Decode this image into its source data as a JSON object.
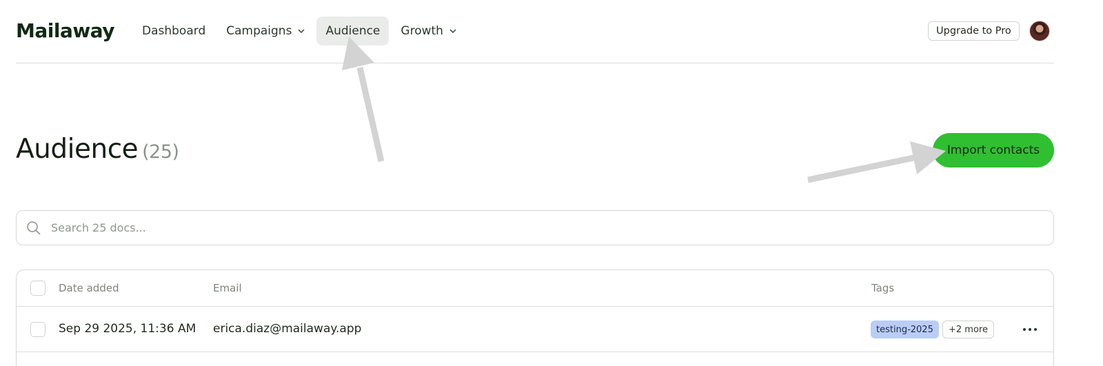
{
  "header": {
    "logo": "Mailaway",
    "nav": [
      {
        "label": "Dashboard",
        "has_dropdown": false,
        "active": false
      },
      {
        "label": "Campaigns",
        "has_dropdown": true,
        "active": false
      },
      {
        "label": "Audience",
        "has_dropdown": false,
        "active": true
      },
      {
        "label": "Growth",
        "has_dropdown": true,
        "active": false
      }
    ],
    "upgrade_label": "Upgrade to Pro"
  },
  "page": {
    "title": "Audience",
    "count": "(25)",
    "import_label": "Import contacts"
  },
  "search": {
    "placeholder": "Search 25 docs..."
  },
  "table": {
    "columns": {
      "date": "Date added",
      "email": "Email",
      "tags": "Tags"
    },
    "rows": [
      {
        "date": "Sep 29 2025, 11:36 AM",
        "email": "erica.diaz@mailaway.app",
        "tag": "testing-2025",
        "more_tags": "+2 more"
      }
    ]
  },
  "colors": {
    "accent_green": "#2fbf30",
    "tag_blue": "#b9cdf7",
    "active_nav": "#e9ece9",
    "annotation_arrow": "#d3d3d3"
  }
}
